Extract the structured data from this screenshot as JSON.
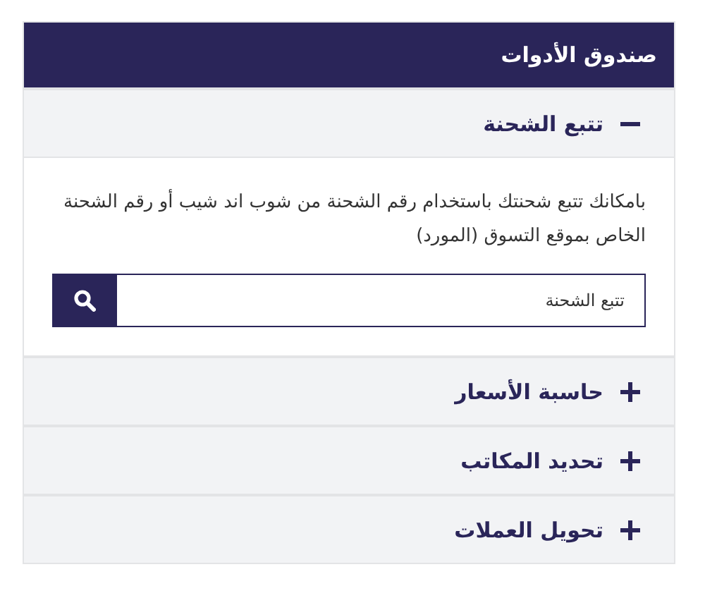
{
  "panel": {
    "title": "صندوق الأدوات"
  },
  "sections": [
    {
      "title": "تتبع الشحنة",
      "expanded": true,
      "description": "بامكانك تتبع شحنتك باستخدام رقم الشحنة من شوب اند شيب أو رقم الشحنة الخاص بموقع التسوق (المورد)",
      "search": {
        "placeholder": "تتبع الشحنة"
      }
    },
    {
      "title": "حاسبة الأسعار",
      "expanded": false
    },
    {
      "title": "تحديد المكاتب",
      "expanded": false
    },
    {
      "title": "تحويل العملات",
      "expanded": false
    }
  ]
}
